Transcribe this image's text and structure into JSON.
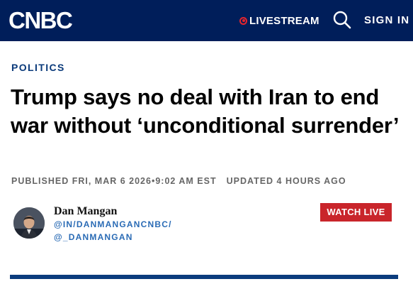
{
  "header": {
    "logo_text": "CNBC",
    "livestream_label": "LIVESTREAM",
    "search_icon": "search-icon",
    "signin_label": "SIGN IN",
    "background_color": "#001e5a",
    "live_color": "#e4252d"
  },
  "article": {
    "kicker": "POLITICS",
    "headline": "Trump says no deal with Iran to end war without ‘unconditional surrender’",
    "published": "PUBLISHED FRI, MAR 6 2026•9:02 AM EST",
    "updated": "UPDATED 4 HOURS AGO",
    "accent_color": "#0a3a7a"
  },
  "author": {
    "name": "Dan Mangan",
    "link_1": "@IN/DANMANGANCNBC/",
    "link_2": "@_DANMANGAN",
    "link_color": "#2a6bb5"
  },
  "watch_live": {
    "label": "WATCH LIVE",
    "color": "#c9252b"
  }
}
